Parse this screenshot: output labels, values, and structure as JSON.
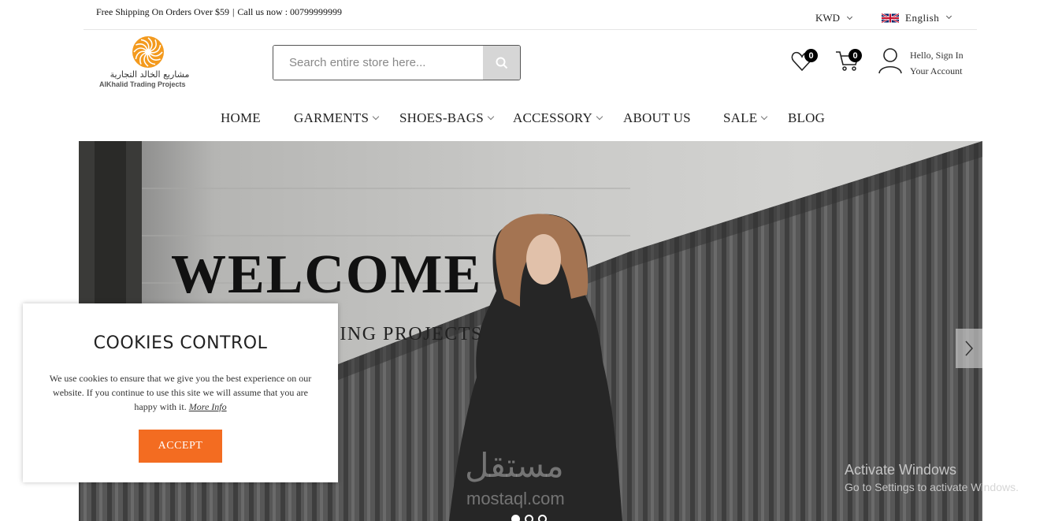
{
  "topbar": {
    "shipping": "Free Shipping On Orders Over $59",
    "separator": "|",
    "call": "Call us now : 00799999999",
    "currency": "KWD",
    "language": "English"
  },
  "logo": {
    "arabic": "مشاريع الخالد التجارية",
    "english": "AlKhalid Trading Projects"
  },
  "search": {
    "placeholder": "Search entire store here...",
    "icon": "search-icon"
  },
  "header": {
    "wishlist_count": "0",
    "cart_count": "0",
    "greeting": "Hello, Sign In",
    "account": "Your Account"
  },
  "nav": {
    "items": [
      {
        "label": "HOME"
      },
      {
        "label": "GARMENTS"
      },
      {
        "label": "SHOES-BAGS"
      },
      {
        "label": "ACCESSORY"
      },
      {
        "label": "ABOUT US"
      },
      {
        "label": "SALE"
      },
      {
        "label": "BLOG"
      }
    ]
  },
  "hero": {
    "title": "WELCOME",
    "subtitle": "ALKHALID TRADING PROJECTS",
    "slides": 3,
    "active_slide": 1
  },
  "cookies": {
    "title": "COOKIES CONTROL",
    "text": "We use cookies to ensure that we give you the best experience on our website. If you continue to use this site we will assume that you are happy with it.",
    "more": "More Info",
    "accept": "ACCEPT"
  },
  "watermark": {
    "arabic": "مستقل",
    "english": "mostaql.com"
  },
  "windows": {
    "line1": "Activate Windows",
    "line2": "Go to Settings to activate Windows."
  },
  "colors": {
    "accent": "#f36c21",
    "logo": "#f39a1e"
  }
}
